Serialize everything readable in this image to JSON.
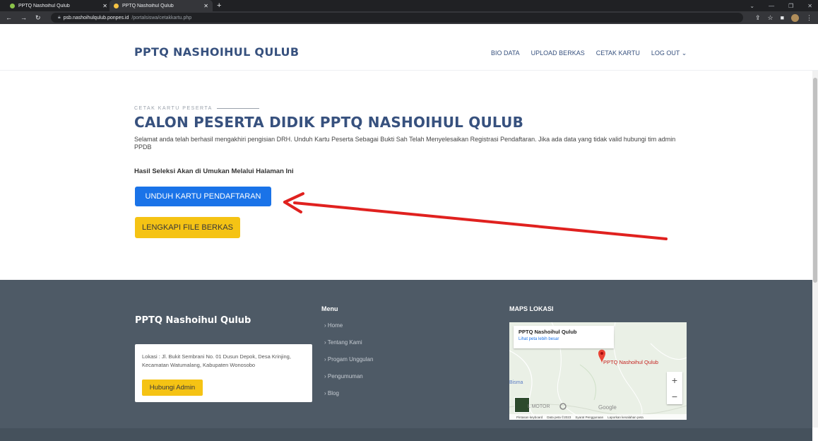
{
  "browser": {
    "tabs": [
      {
        "title": "PPTQ Nashoihul Qulub",
        "active": false
      },
      {
        "title": "PPTQ Nashoihul Qulub",
        "active": true
      }
    ],
    "new_tab_symbol": "+",
    "url_host": "psb.nashoihulqulub.ponpes.id",
    "url_path": "/portalsiswa/cetakkartu.php",
    "icons": [
      "back-icon",
      "forward-icon",
      "reload-icon",
      "lock-icon",
      "share-icon",
      "star-icon",
      "sidebar-icon",
      "profile-avatar",
      "more-icon"
    ]
  },
  "header": {
    "brand": "PPTQ NASHOIHUL QULUB",
    "menu": [
      "BIO DATA",
      "UPLOAD BERKAS",
      "CETAK KARTU",
      "LOG OUT"
    ]
  },
  "main": {
    "eyebrow": "CETAK KARTU PESERTA",
    "title": "CALON PESERTA DIDIK PPTQ NASHOIHUL QULUB",
    "description": "Selamat anda telah berhasil mengakhiri pengisian DRH. Unduh Kartu Peserta Sebagai Bukti Sah Telah Menyelesaikan Registrasi Pendaftaran. Jika ada data yang tidak valid hubungi tim admin PPDB",
    "hasil": "Hasil Seleksi Akan di Umukan Melalui Halaman Ini",
    "btn_unduh": "UNDUH KARTU PENDAFTARAN",
    "btn_lengkapi": "LENGKAPI FILE BERKAS"
  },
  "footer": {
    "brand": "PPTQ Nashoihul Qulub",
    "address": "Lokasi : Jl. Bukit Sembrani No. 01 Dusun Depok, Desa Krinjing, Kecamatan Watumalang, Kabupaten Wonosobo",
    "btn_admin": "Hubungi Admin",
    "menu_title": "Menu",
    "menu": [
      "Home",
      "Tentang Kami",
      "Progam Unggulan",
      "Pengumuman",
      "Blog"
    ],
    "maps_title": "MAPS LOKASI",
    "map": {
      "card_title": "PPTQ Nashoihul Qulub",
      "card_link": "Lihat peta lebih besar",
      "pin_label": "PPTQ Nashoihul Qulub",
      "place": "Bisma",
      "motor": "L MOTOR",
      "google": "Google",
      "zoom_in": "+",
      "zoom_out": "−",
      "footer": [
        "Pintasan keyboard",
        "Data peta ©2023",
        "Syarat Penggunaan",
        "Laporkan kesalahan peta"
      ]
    }
  },
  "colors": {
    "primary": "#37517e",
    "button_blue": "#1a73e8",
    "button_yellow": "#f5c314",
    "footer_bg": "#4e5a66",
    "annotation_arrow": "#e0211f"
  }
}
